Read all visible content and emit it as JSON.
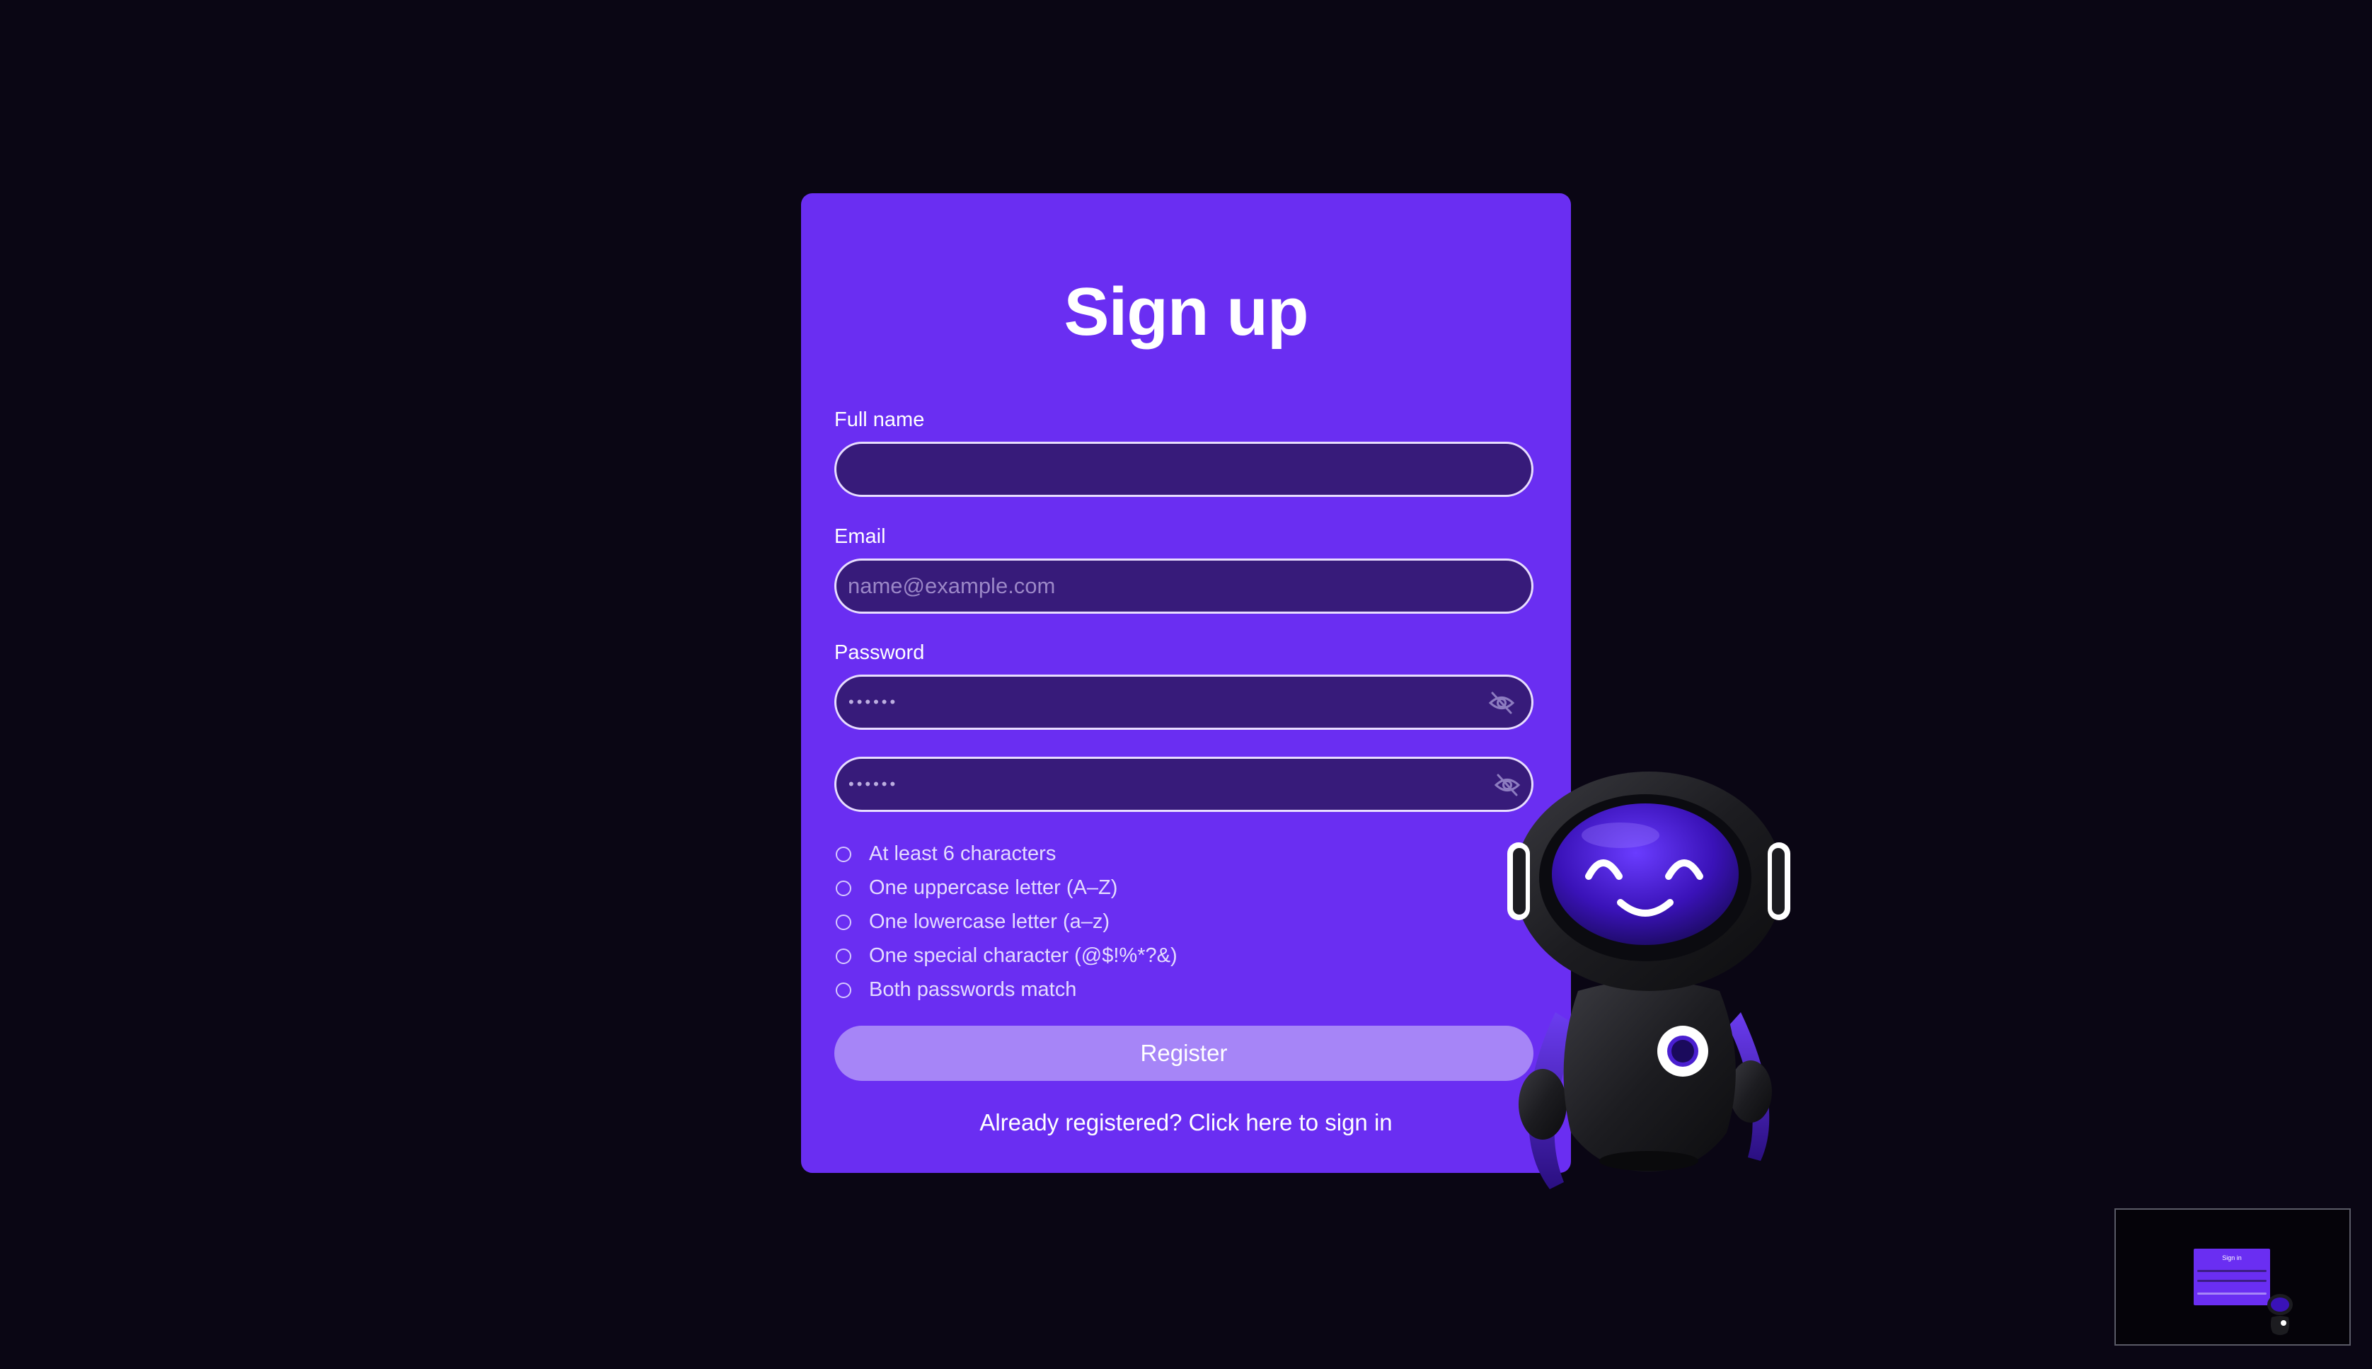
{
  "form": {
    "title": "Sign up",
    "full_name": {
      "label": "Full name",
      "value": "",
      "placeholder": ""
    },
    "email": {
      "label": "Email",
      "value": "",
      "placeholder": "name@example.com"
    },
    "password": {
      "label": "Password",
      "masked_value": "••••••",
      "visibility_icon": "eye-off-icon"
    },
    "confirm_password": {
      "masked_value": "••••••",
      "visibility_icon": "eye-off-icon"
    },
    "requirements": [
      {
        "text": "At least 6 characters",
        "met": false
      },
      {
        "text": "One uppercase letter (A–Z)",
        "met": false
      },
      {
        "text": "One lowercase letter (a–z)",
        "met": false
      },
      {
        "text": "One special character (@$!%*?&)",
        "met": false
      },
      {
        "text": "Both passwords match",
        "met": false
      }
    ],
    "register_label": "Register",
    "signin_link": "Already registered? Click here to sign in"
  },
  "minimap": {
    "title": "Sign in"
  },
  "colors": {
    "background": "#0a0614",
    "card": "#6a2ef2",
    "input": "#371b7a",
    "register_button": "#a685f7"
  },
  "icons": {
    "mascot": "robot-mascot",
    "requirement_status": "circle-outline-icon"
  }
}
